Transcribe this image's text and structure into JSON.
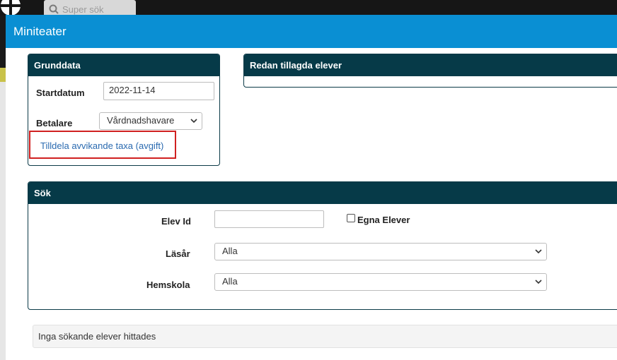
{
  "background": {
    "search_placeholder": "Super sök"
  },
  "modal": {
    "title": "Miniteater"
  },
  "grunddata": {
    "title": "Grunddata",
    "startdatum_label": "Startdatum",
    "startdatum_value": "2022-11-14",
    "betalare_label": "Betalare",
    "betalare_value": "Vårdnadshavare",
    "link_label": "Tilldela avvikande taxa (avgift)"
  },
  "redan": {
    "title": "Redan tillagda elever"
  },
  "sok": {
    "title": "Sök",
    "elev_id_label": "Elev Id",
    "elev_id_value": "",
    "egna_elever_label": "Egna Elever",
    "lasar_label": "Läsår",
    "lasar_value": "Alla",
    "hemskola_label": "Hemskola",
    "hemskola_value": "Alla"
  },
  "results": {
    "message": "Inga sökande elever hittades"
  },
  "colors": {
    "modal_header": "#0a8fd3",
    "panel_header": "#063a48",
    "link": "#2a6ab0",
    "highlight": "#d02020"
  }
}
